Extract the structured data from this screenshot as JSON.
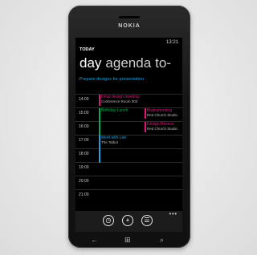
{
  "device": {
    "brand": "NOKIA"
  },
  "status": {
    "time": "13:21"
  },
  "header": {
    "small_title": "TODAY",
    "pivots": [
      "day",
      "agenda",
      "to-"
    ]
  },
  "allday": {
    "text": "Prepare designs for presentation"
  },
  "hours": [
    "14:00",
    "15:00",
    "16:00",
    "17:00",
    "18:00",
    "19:00",
    "20:00",
    "21:00"
  ],
  "events": [
    {
      "title": "Initial design meeting",
      "sub": "Conference Room 303",
      "color": "#e3177b"
    },
    {
      "title": "Birthday Lunch",
      "sub": "",
      "color": "#00b050"
    },
    {
      "title": "Brainstorming",
      "sub": "Red Church Studio",
      "color": "#e3177b"
    },
    {
      "title": "Design Review",
      "sub": "Red Church Studio",
      "color": "#e3177b"
    },
    {
      "title": "Meet with Lee",
      "sub": "The Talbot",
      "color": "#1ba1e2"
    }
  ],
  "appbar": {
    "buttons": [
      "today-icon",
      "add-icon",
      "list-icon"
    ],
    "more": "•••"
  },
  "hardware": {
    "back": "←",
    "start": "⊞",
    "search": "⌕"
  },
  "colors": {
    "accent": "#1ba1e2",
    "pink": "#e3177b",
    "green": "#00b050"
  }
}
